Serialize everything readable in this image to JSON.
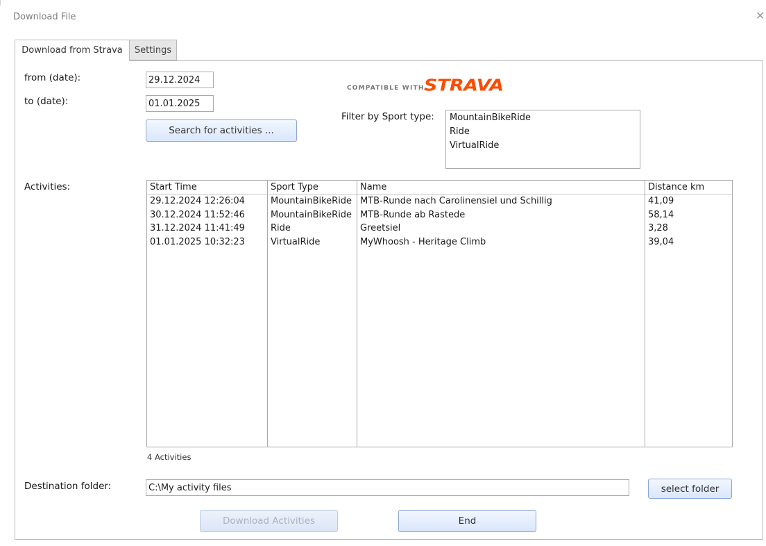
{
  "window": {
    "title": "Download File",
    "close_glyph": "✕"
  },
  "tabs": [
    {
      "label": "Download from Strava",
      "active": true
    },
    {
      "label": "Settings",
      "active": false
    }
  ],
  "form": {
    "from_label": "from (date):",
    "from_value": "29.12.2024",
    "to_label": "to (date):",
    "to_value": "01.01.2025",
    "search_button": "Search for activities ..."
  },
  "brand": {
    "compatible_text": "COMPATIBLE WITH",
    "strava_text": "STRAVA",
    "strava_color": "#fc4c02"
  },
  "filter": {
    "label": "Filter by Sport type:",
    "options": [
      "MountainBikeRide",
      "Ride",
      "VirtualRide"
    ]
  },
  "activities": {
    "label": "Activities:",
    "columns": [
      "Start Time",
      "Sport Type",
      "Name",
      "Distance km"
    ],
    "rows": [
      [
        "29.12.2024 12:26:04",
        "MountainBikeRide",
        "MTB-Runde nach Carolinensiel und Schillig",
        "41,09"
      ],
      [
        "30.12.2024 11:52:46",
        "MountainBikeRide",
        "MTB-Runde ab Rastede",
        "58,14"
      ],
      [
        "31.12.2024 11:41:49",
        "Ride",
        "Greetsiel",
        "3,28"
      ],
      [
        "01.01.2025 10:32:23",
        "VirtualRide",
        "MyWhoosh - Heritage Climb",
        "39,04"
      ]
    ],
    "count_text": "4 Activities"
  },
  "destination": {
    "label": "Destination folder:",
    "value": "C:\\My activity files",
    "select_button": "select folder"
  },
  "actions": {
    "download_button": "Download Activities",
    "download_disabled": true,
    "end_button": "End"
  }
}
